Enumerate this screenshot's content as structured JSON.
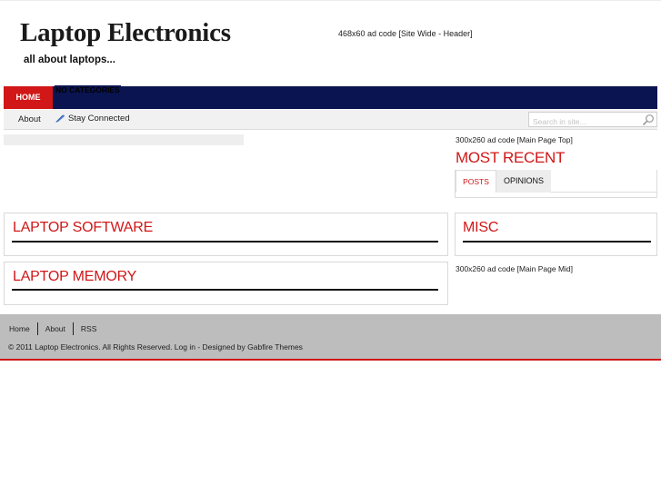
{
  "header": {
    "site_title": "Laptop Electronics",
    "tagline": "all about laptops...",
    "ad_text": "468x60 ad code [Site Wide - Header]"
  },
  "nav": {
    "home_label": "HOME",
    "categories_label": "NO CATEGORIES"
  },
  "subnav": {
    "about_label": "About",
    "stay_connected_label": "Stay Connected",
    "stay_connected_icon": "rss-feather-icon",
    "search_placeholder": "Search in site...",
    "search_icon": "search-icon"
  },
  "sidebar": {
    "ad_top": "300x260 ad code [Main Page Top]",
    "most_recent_title": "MOST RECENT",
    "tabs": [
      {
        "label": "POSTS",
        "active": true
      },
      {
        "label": "OPINIONS",
        "active": false
      }
    ],
    "misc_title": "MISC",
    "ad_mid": "300x260 ad code [Main Page Mid]"
  },
  "sections": [
    {
      "title": "LAPTOP SOFTWARE"
    },
    {
      "title": "LAPTOP MEMORY"
    }
  ],
  "footer": {
    "links": [
      "Home",
      "About",
      "RSS"
    ],
    "copyright": "© 2011 Laptop Electronics. All Rights Reserved. Log in - Designed by Gabfire Themes"
  },
  "colors": {
    "accent": "#d11717",
    "navbar": "#0a1450",
    "footer_bg": "#bdbdbd"
  }
}
